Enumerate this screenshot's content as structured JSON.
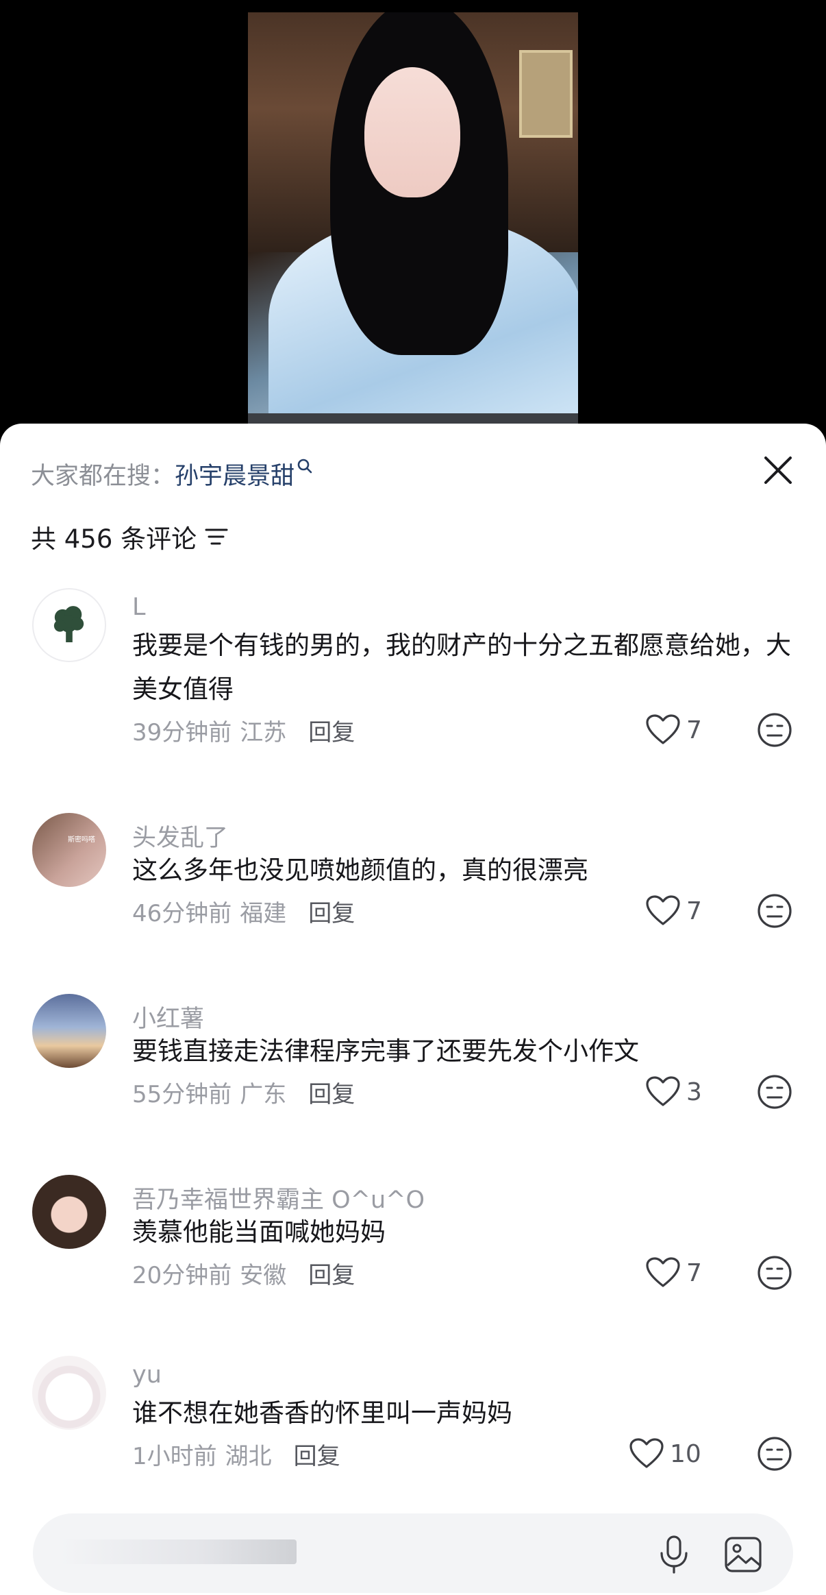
{
  "search": {
    "prefix": "大家都在搜：",
    "term": "孙宇晨景甜"
  },
  "comments_header": {
    "count_text": "共 456 条评论"
  },
  "comments": [
    {
      "username": "L",
      "text": "我要是个有钱的男的，我的财产的十分之五都愿意给她，大美女值得",
      "time": "39分钟前",
      "location": "江苏",
      "reply": "回复",
      "likes": "7",
      "avatar_icon": "broccoli-icon"
    },
    {
      "username": "头发乱了",
      "text": "这么多年也没见喷她颜值的，真的很漂亮",
      "time": "46分钟前",
      "location": "福建",
      "reply": "回复",
      "likes": "7",
      "avatar_label": "斯密吗嗒"
    },
    {
      "username": "小红薯",
      "text": "要钱直接走法律程序完事了还要先发个小作文",
      "time": "55分钟前",
      "location": "广东",
      "reply": "回复",
      "likes": "3"
    },
    {
      "username": "吾乃幸福世界霸主 O^u^O",
      "text": "羡慕他能当面喊她妈妈",
      "time": "20分钟前",
      "location": "安徽",
      "reply": "回复",
      "likes": "7"
    },
    {
      "username": "yu",
      "text": "谁不想在她香香的怀里叫一声妈妈",
      "time": "1小时前",
      "location": "湖北",
      "reply": "回复",
      "likes": "10"
    }
  ],
  "colors": {
    "search_term": "#26406a",
    "muted_text": "#9a9ca3",
    "body_text": "#17171b"
  }
}
